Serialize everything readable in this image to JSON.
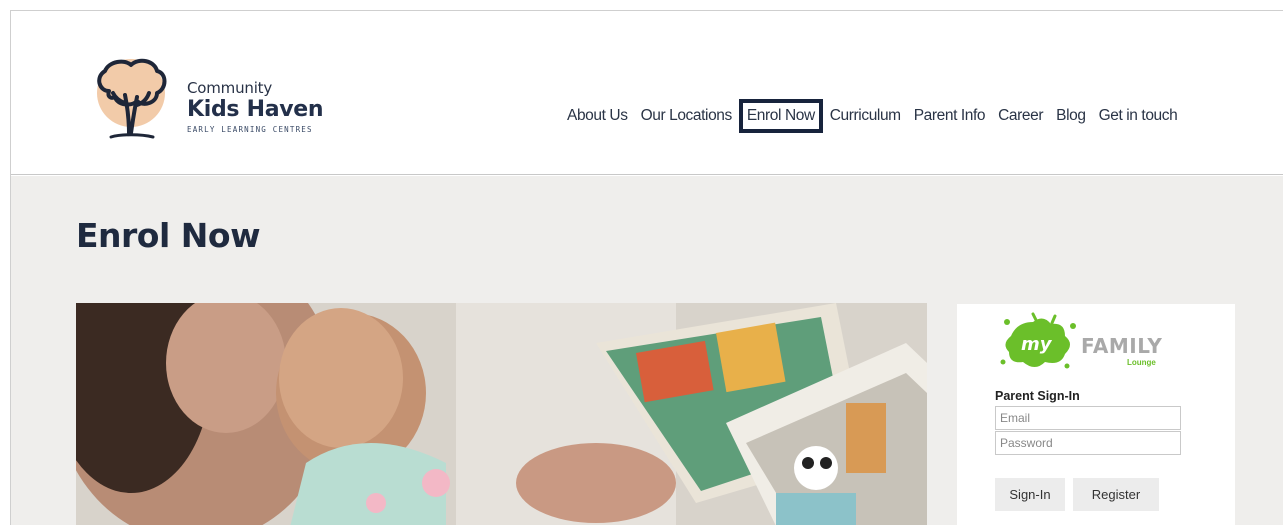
{
  "brand": {
    "line1": "Community",
    "line2": "Kids Haven",
    "line3": "EARLY LEARNING CENTRES"
  },
  "nav": {
    "items": [
      {
        "label": "About Us"
      },
      {
        "label": "Our Locations"
      },
      {
        "label": "Enrol Now",
        "active": true
      },
      {
        "label": "Curriculum"
      },
      {
        "label": "Parent Info"
      },
      {
        "label": "Career"
      },
      {
        "label": "Blog"
      },
      {
        "label": "Get in touch"
      }
    ]
  },
  "page": {
    "title": "Enrol Now"
  },
  "sidebar": {
    "logo_word_my": "my",
    "logo_word_family": "FAMILY",
    "logo_word_lounge": "Lounge",
    "signin_heading": "Parent Sign-In",
    "email_placeholder": "Email",
    "password_placeholder": "Password",
    "signin_button": "Sign-In",
    "register_button": "Register"
  },
  "colors": {
    "brand_navy": "#1f2a3f",
    "active_border": "#17233c",
    "page_bg": "#efeeec",
    "lounge_green": "#6bbf2a"
  }
}
